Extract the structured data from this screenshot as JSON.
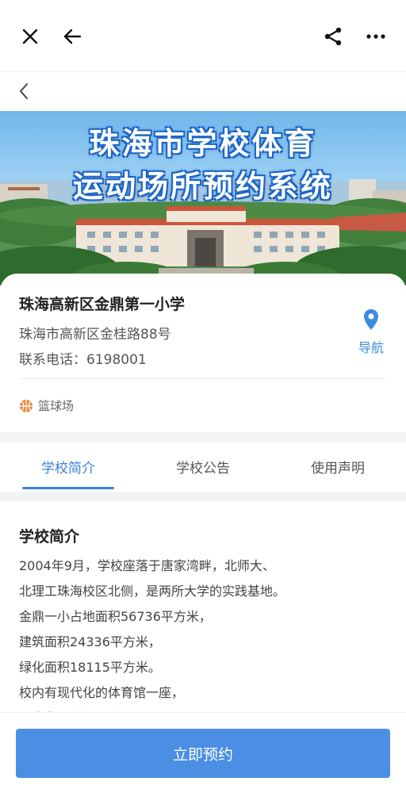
{
  "topbar": {
    "icons": [
      "close-icon",
      "arrow-left-icon",
      "share-icon",
      "more-icon"
    ]
  },
  "banner": {
    "line1": "珠海市学校体育",
    "line2": "运动场所预约系统"
  },
  "school": {
    "name": "珠海高新区金鼎第一小学",
    "address": "珠海市高新区金桂路88号",
    "phone": "联系电话：6198001",
    "nav_label": "导航",
    "facility": "篮球场"
  },
  "tabs": [
    {
      "label": "学校简介",
      "active": true
    },
    {
      "label": "学校公告",
      "active": false
    },
    {
      "label": "使用声明",
      "active": false
    }
  ],
  "intro": {
    "title": "学校简介",
    "lines": [
      "2004年9月，学校座落于唐家湾畔，北师大、",
      "北理工珠海校区北侧，是两所大学的实践基地。",
      "金鼎一小占地面积56736平方米，",
      "建筑面积24336平方米，",
      "绿化面积18115平方米。",
      "校内有现代化的体育馆一座，",
      "现代化运动场一个"
    ]
  },
  "actions": {
    "book": "立即预约"
  },
  "colors": {
    "accent": "#3b82d9",
    "button": "#4a8fe4",
    "nav": "#3b8be0",
    "facility_icon": "#e08a3a"
  }
}
